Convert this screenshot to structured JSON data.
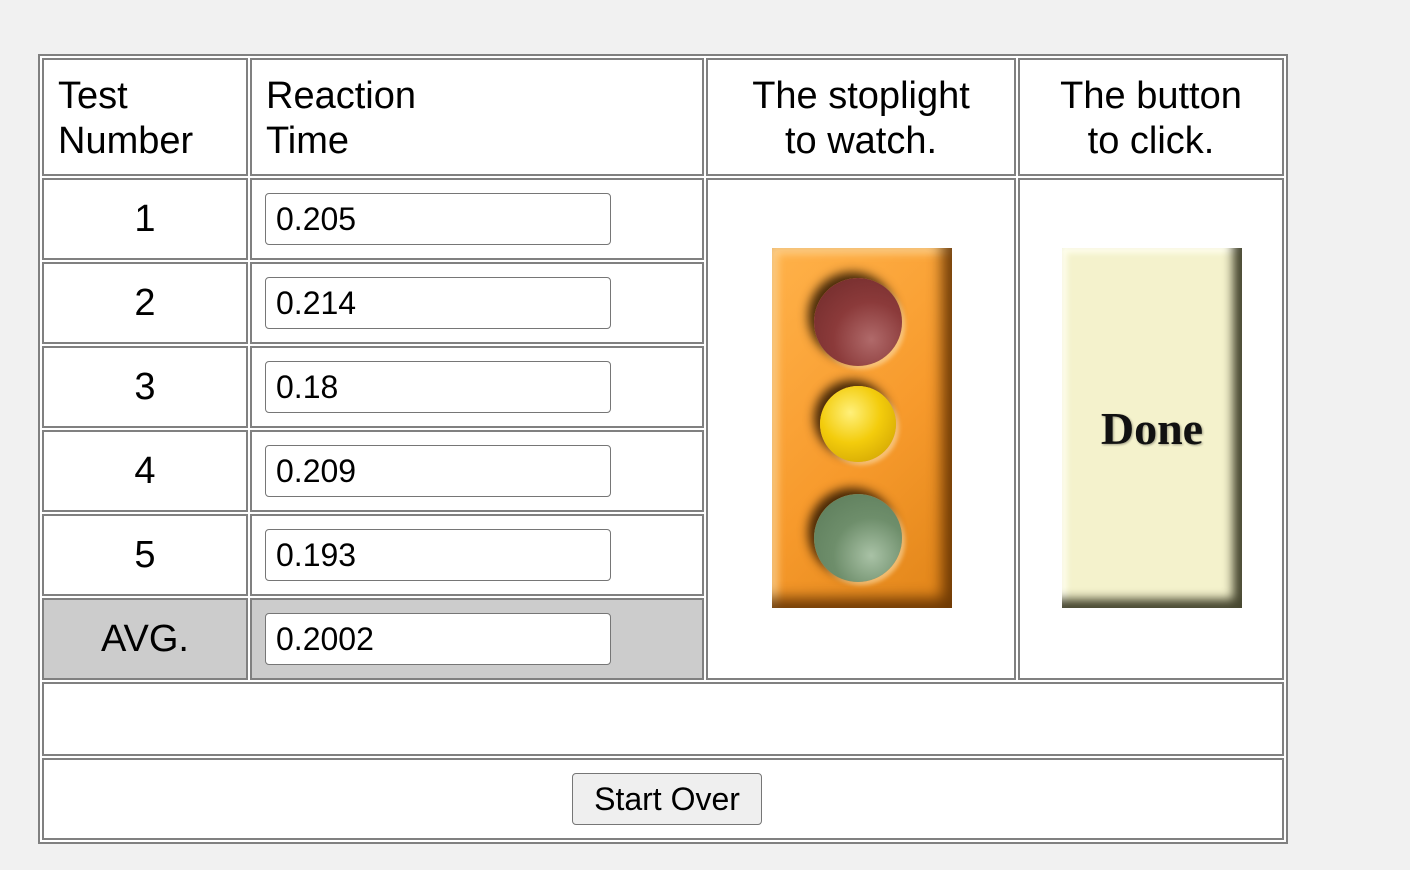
{
  "headers": {
    "test_number": [
      "Test",
      "Number"
    ],
    "reaction_time": [
      "Reaction",
      "Time"
    ],
    "stoplight": [
      "The stoplight",
      "to watch."
    ],
    "button": [
      "The button",
      "to click."
    ]
  },
  "rows": [
    {
      "number": "1",
      "time": "0.205"
    },
    {
      "number": "2",
      "time": "0.214"
    },
    {
      "number": "3",
      "time": "0.18"
    },
    {
      "number": "4",
      "time": "0.209"
    },
    {
      "number": "5",
      "time": "0.193"
    }
  ],
  "average": {
    "label": "AVG.",
    "value": "0.2002"
  },
  "stoplight": {
    "lights": [
      "red",
      "yellow",
      "green"
    ],
    "body_color": "#f79a2c"
  },
  "done_button": {
    "label": "Done",
    "color": "#f4f2cc"
  },
  "status_message": "",
  "start_over_label": "Start Over",
  "colors": {
    "page_background": "#f1f1f1",
    "avg_row": "#cccccc",
    "border": "#808080"
  }
}
